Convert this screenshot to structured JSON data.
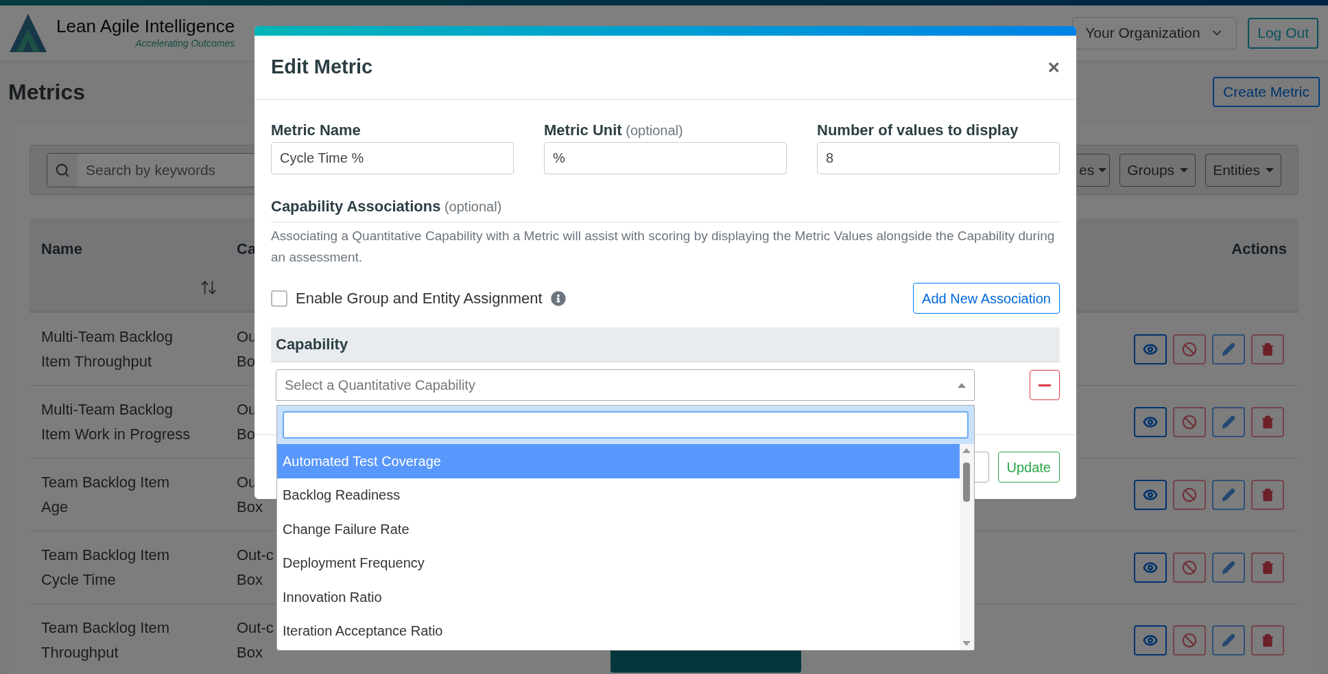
{
  "header": {
    "logo_title": "Lean Agile Intelligence",
    "logo_subtitle": "Accelerating Outcomes",
    "organization_select": "Your Organization",
    "logout": "Log Out"
  },
  "page": {
    "title": "Metrics",
    "create_button": "Create Metric",
    "search": {
      "placeholder": "Search by keywords"
    },
    "filters": [
      "es",
      "Groups",
      "Entities"
    ],
    "table": {
      "columns": [
        "Name",
        "Ca",
        "Actions"
      ],
      "rows": [
        {
          "name": [
            "Multi-Team Backlog",
            "Item Throughput"
          ],
          "column_2": [
            "Ou",
            "Bo"
          ]
        },
        {
          "name": [
            "Multi-Team Backlog",
            "Item Work in Progress"
          ],
          "column_2": [
            "Ou",
            "Bo"
          ]
        },
        {
          "name": [
            "Team Backlog Item",
            "Age"
          ],
          "column_2": [
            "Ou",
            "Box"
          ]
        },
        {
          "name": [
            "Team Backlog Item",
            "Cycle Time"
          ],
          "column_2": [
            "Out-c",
            "Box"
          ]
        },
        {
          "name": [
            "Team Backlog Item",
            "Throughput"
          ],
          "column_2": [
            "Out-c",
            "Box"
          ]
        }
      ]
    }
  },
  "modal": {
    "title": "Edit Metric",
    "close": "×",
    "fields": [
      {
        "label": "Metric Name",
        "value": "Cycle Time %"
      },
      {
        "label": "Metric Unit",
        "hint": "(optional)",
        "value": "%"
      },
      {
        "label": "Number of values to display",
        "value": "8"
      }
    ],
    "associations": {
      "title": "Capability Associations",
      "hint": "(optional)",
      "description": "Associating a Quantitative Capability with a Metric will assist with scoring by displaying the Metric Values alongside the Capability during an assessment.",
      "checkbox": {
        "label": "Enable Group and Entity Assignment",
        "checked": false
      },
      "add_button": "Add New Association",
      "table_header": "Capability",
      "select": {
        "placeholder": "Select a Quantitative Capability",
        "expanded": true
      },
      "options": [
        {
          "label": "Automated Test Coverage",
          "selected": true
        },
        {
          "label": "Backlog Readiness",
          "selected": false
        },
        {
          "label": "Change Failure Rate",
          "selected": false
        },
        {
          "label": "Deployment Frequency",
          "selected": false
        },
        {
          "label": "Innovation Ratio",
          "selected": false
        },
        {
          "label": "Iteration Acceptance Ratio",
          "selected": false
        }
      ]
    },
    "update_button": "Update"
  }
}
